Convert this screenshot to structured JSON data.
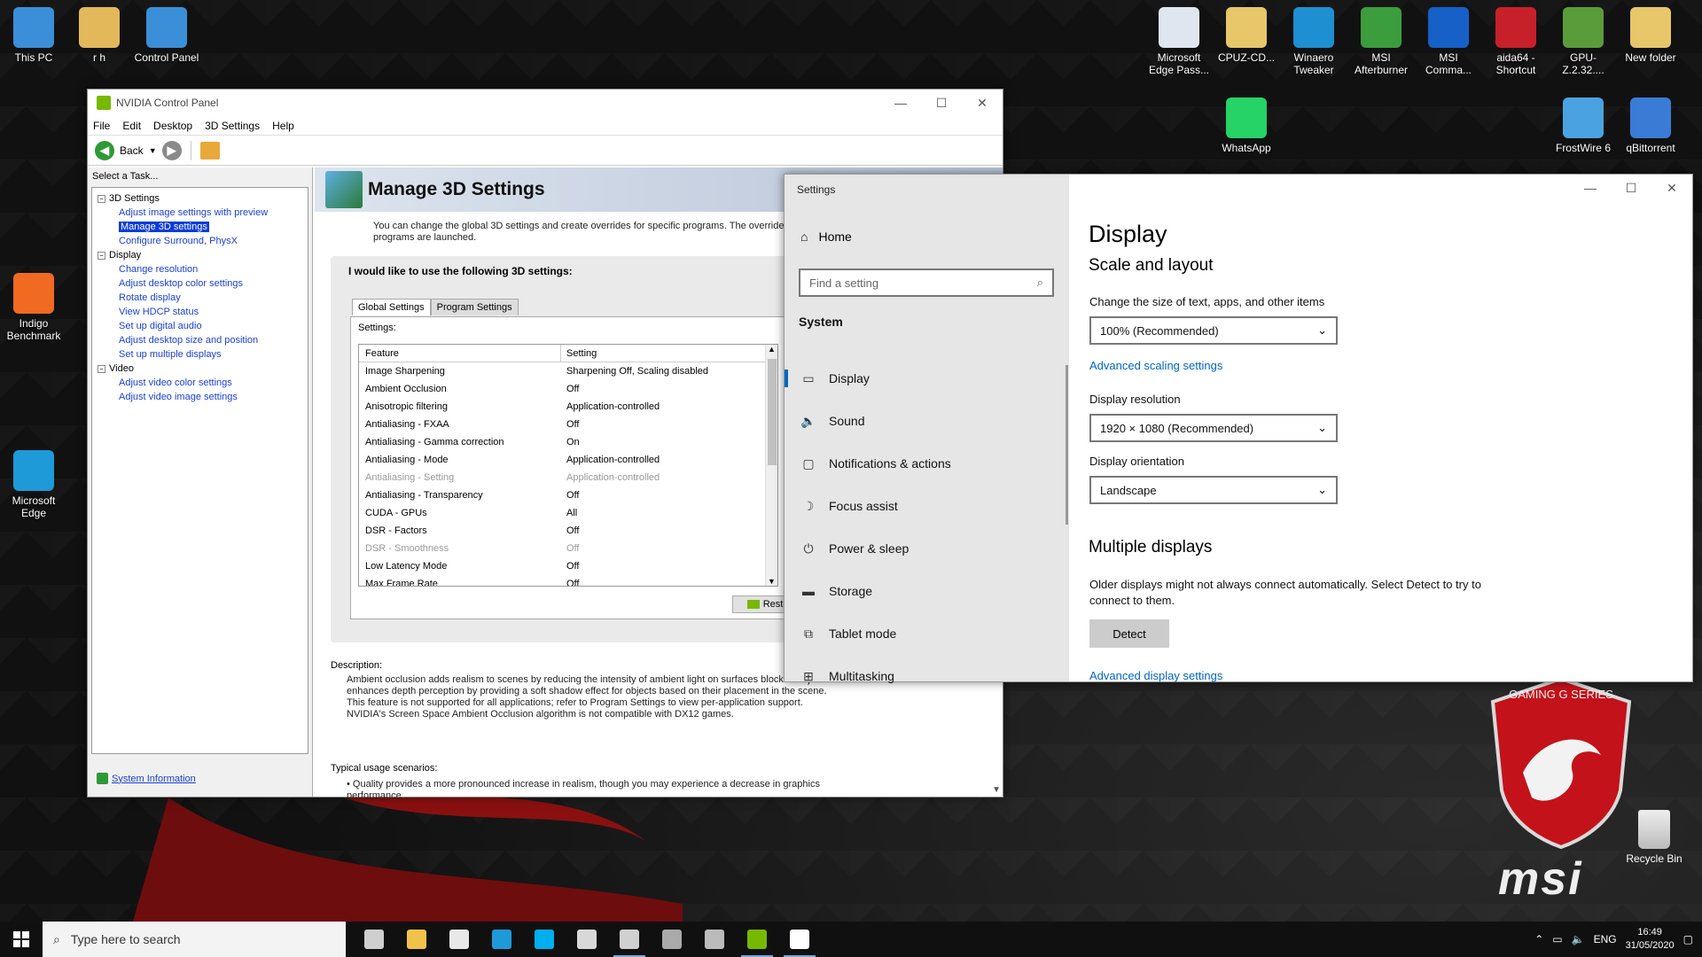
{
  "desktop": {
    "icons": [
      {
        "label": "This PC",
        "icon": "computer-icon",
        "color": "#3a8fd8"
      },
      {
        "label": "r h",
        "icon": "user-folder-icon",
        "color": "#e2b85a"
      },
      {
        "label": "Control Panel",
        "icon": "control-panel-icon",
        "color": "#3a8fd8"
      },
      {
        "label": "Indigo Benchmark",
        "icon": "indigo-icon",
        "color": "#f06a22"
      },
      {
        "label": "Microsoft Edge",
        "icon": "edge-icon",
        "color": "#1f9ad8"
      },
      {
        "label": "Microsoft Edge Pass...",
        "icon": "document-icon",
        "color": "#dfe6ef"
      },
      {
        "label": "CPUZ-CD...",
        "icon": "folder-icon",
        "color": "#e8c66a"
      },
      {
        "label": "Winaero Tweaker",
        "icon": "winaero-icon",
        "color": "#1e8fd0"
      },
      {
        "label": "MSI Afterburner",
        "icon": "afterburner-icon",
        "color": "#3c9d3c"
      },
      {
        "label": "MSI Comma...",
        "icon": "msi-command-icon",
        "color": "#1660c8"
      },
      {
        "label": "aida64 - Shortcut",
        "icon": "aida64-icon",
        "color": "#c8202a"
      },
      {
        "label": "GPU-Z.2.32....",
        "icon": "gpuz-icon",
        "color": "#5a9c3a"
      },
      {
        "label": "New folder",
        "icon": "folder-icon",
        "color": "#e8c66a"
      },
      {
        "label": "WhatsApp",
        "icon": "whatsapp-icon",
        "color": "#25d366"
      },
      {
        "label": "FrostWire 6",
        "icon": "frostwire-icon",
        "color": "#4aa3e0"
      },
      {
        "label": "qBittorrent",
        "icon": "qbittorrent-icon",
        "color": "#3a7bd5"
      }
    ],
    "recycle_bin": "Recycle Bin",
    "msi_word": "msi",
    "msi_shield_text": "GAMING G SERIES"
  },
  "nvidia": {
    "title": "NVIDIA Control Panel",
    "menu": [
      "File",
      "Edit",
      "Desktop",
      "3D Settings",
      "Help"
    ],
    "back_label": "Back",
    "select_task": "Select a Task...",
    "tree": {
      "groups": [
        {
          "label": "3D Settings",
          "items": [
            "Adjust image settings with preview",
            "Manage 3D settings",
            "Configure Surround, PhysX"
          ],
          "selected": 1
        },
        {
          "label": "Display",
          "items": [
            "Change resolution",
            "Adjust desktop color settings",
            "Rotate display",
            "View HDCP status",
            "Set up digital audio",
            "Adjust desktop size and position",
            "Set up multiple displays"
          ],
          "selected": -1
        },
        {
          "label": "Video",
          "items": [
            "Adjust video color settings",
            "Adjust video image settings"
          ],
          "selected": -1
        }
      ]
    },
    "system_information": "System Information",
    "page_title": "Manage 3D Settings",
    "intro": "You can change the global 3D settings and create overrides for specific programs. The overrides w programs are launched.",
    "panel_title": "I would like to use the following 3D settings:",
    "tabs": [
      "Global Settings",
      "Program Settings"
    ],
    "settings_label": "Settings:",
    "columns": [
      "Feature",
      "Setting"
    ],
    "rows": [
      {
        "feature": "Image Sharpening",
        "setting": "Sharpening Off, Scaling disabled",
        "dim": false
      },
      {
        "feature": "Ambient Occlusion",
        "setting": "Off",
        "dim": false
      },
      {
        "feature": "Anisotropic filtering",
        "setting": "Application-controlled",
        "dim": false
      },
      {
        "feature": "Antialiasing - FXAA",
        "setting": "Off",
        "dim": false
      },
      {
        "feature": "Antialiasing - Gamma correction",
        "setting": "On",
        "dim": false
      },
      {
        "feature": "Antialiasing - Mode",
        "setting": "Application-controlled",
        "dim": false
      },
      {
        "feature": "Antialiasing - Setting",
        "setting": "Application-controlled",
        "dim": true
      },
      {
        "feature": "Antialiasing - Transparency",
        "setting": "Off",
        "dim": false
      },
      {
        "feature": "CUDA - GPUs",
        "setting": "All",
        "dim": false
      },
      {
        "feature": "DSR - Factors",
        "setting": "Off",
        "dim": false
      },
      {
        "feature": "DSR - Smoothness",
        "setting": "Off",
        "dim": true
      },
      {
        "feature": "Low Latency Mode",
        "setting": "Off",
        "dim": false
      },
      {
        "feature": "Max Frame Rate",
        "setting": "Off",
        "dim": false
      }
    ],
    "restore": "Restore",
    "description_label": "Description:",
    "description": "Ambient occlusion adds realism to scenes by reducing the intensity of ambient light on surfaces blocked objects. It enhances depth perception by providing a soft shadow effect for objects based on their placement in the scene. This feature is not supported for all applications; refer to Program Settings to view per-application support. NVIDIA's Screen Space Ambient Occlusion algorithm is not compatible with DX12 games.",
    "usage_label": "Typical usage scenarios:",
    "usage": "• Quality provides a more pronounced increase in realism, though you may experience a decrease in graphics performance"
  },
  "settings": {
    "title": "Settings",
    "home": "Home",
    "search_placeholder": "Find a setting",
    "section": "System",
    "nav": [
      {
        "label": "Display",
        "icon": "monitor-icon",
        "glyph": "▭"
      },
      {
        "label": "Sound",
        "icon": "speaker-icon",
        "glyph": "🔈"
      },
      {
        "label": "Notifications & actions",
        "icon": "notification-icon",
        "glyph": "▢"
      },
      {
        "label": "Focus assist",
        "icon": "moon-icon",
        "glyph": "☽"
      },
      {
        "label": "Power & sleep",
        "icon": "power-icon",
        "glyph": "⏻"
      },
      {
        "label": "Storage",
        "icon": "storage-icon",
        "glyph": "▬"
      },
      {
        "label": "Tablet mode",
        "icon": "tablet-icon",
        "glyph": "⧉"
      },
      {
        "label": "Multitasking",
        "icon": "multitasking-icon",
        "glyph": "⊞"
      }
    ],
    "page_title": "Display",
    "subtitle": "Scale and layout",
    "scale_label": "Change the size of text, apps, and other items",
    "scale_value": "100% (Recommended)",
    "advanced_scaling": "Advanced scaling settings",
    "resolution_label": "Display resolution",
    "resolution_value": "1920 × 1080 (Recommended)",
    "orientation_label": "Display orientation",
    "orientation_value": "Landscape",
    "multiple_title": "Multiple displays",
    "multiple_text": "Older displays might not always connect automatically. Select Detect to try to connect to them.",
    "detect": "Detect",
    "advanced_display": "Advanced display settings"
  },
  "taskbar": {
    "search_placeholder": "Type here to search",
    "apps": [
      {
        "icon": "task-view-icon",
        "color": "#cfcfcf",
        "open": false
      },
      {
        "icon": "file-explorer-icon",
        "color": "#f0c24a",
        "open": false
      },
      {
        "icon": "store-icon",
        "color": "#e8e8e8",
        "open": false
      },
      {
        "icon": "edge-icon",
        "color": "#1f9ad8",
        "open": false
      },
      {
        "icon": "skype-icon",
        "color": "#00aff0",
        "open": false
      },
      {
        "icon": "mail-icon",
        "color": "#d8d8d8",
        "open": false
      },
      {
        "icon": "msi-dragon-icon",
        "color": "#d0d0d0",
        "open": true
      },
      {
        "icon": "keyboard-icon",
        "color": "#aaaaaa",
        "open": false
      },
      {
        "icon": "device-icon",
        "color": "#bbbbbb",
        "open": false
      },
      {
        "icon": "nvidia-icon",
        "color": "#76b900",
        "open": true
      },
      {
        "icon": "settings-gear-icon",
        "color": "#ffffff",
        "open": true
      }
    ],
    "lang": "ENG",
    "time": "16:49",
    "date": "31/05/2020"
  }
}
